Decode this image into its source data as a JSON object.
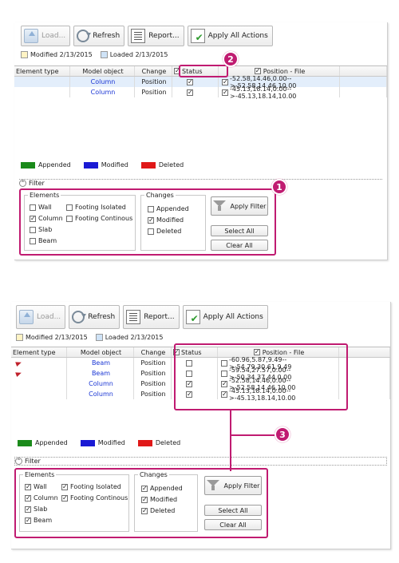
{
  "toolbar": {
    "load_label": "Load...",
    "refresh_label": "Refresh",
    "report_label": "Report...",
    "apply_label": "Apply All Actions"
  },
  "info": {
    "modified": "Modified 2/13/2015",
    "loaded": "Loaded 2/13/2015"
  },
  "grid": {
    "columns": [
      "Element type",
      "Model object",
      "Change",
      "Status",
      "Position - File"
    ]
  },
  "panel1": {
    "rows": [
      {
        "object": "Column",
        "change": "Position",
        "status": true,
        "file_checked": true,
        "position": "-52.58,14.46,0.00-->-52.58,14.46,10.00"
      },
      {
        "object": "Column",
        "change": "Position",
        "status": true,
        "file_checked": true,
        "position": "-45.13,18.14,0.00-->-45.13,18.14,10.00"
      }
    ],
    "elements": [
      {
        "label": "Wall",
        "checked": false
      },
      {
        "label": "Footing Isolated",
        "checked": false
      },
      {
        "label": "Column",
        "checked": true
      },
      {
        "label": "Footing Continous",
        "checked": false
      },
      {
        "label": "Slab",
        "checked": false
      },
      {
        "label": "Beam",
        "checked": false
      }
    ],
    "changes": [
      {
        "label": "Appended",
        "checked": false
      },
      {
        "label": "Modified",
        "checked": true
      },
      {
        "label": "Deleted",
        "checked": false
      }
    ]
  },
  "panel2": {
    "rows": [
      {
        "object": "Beam",
        "change": "Position",
        "status": false,
        "file_checked": false,
        "flag": true,
        "position": "-60.96,5.87,9.49-->-54.79,30.61,9.49"
      },
      {
        "object": "Beam",
        "change": "Position",
        "status": false,
        "file_checked": false,
        "flag": true,
        "position": "-59.54,27.57,0.00-->-50.34,37.44,0.00"
      },
      {
        "object": "Column",
        "change": "Position",
        "status": true,
        "file_checked": true,
        "flag": false,
        "position": "-52.58,14.46,0.00-->-52.58,14.46,10.00"
      },
      {
        "object": "Column",
        "change": "Position",
        "status": true,
        "file_checked": true,
        "flag": false,
        "position": "-45.13,18.14,0.00-->-45.13,18.14,10.00"
      }
    ],
    "elements": [
      {
        "label": "Wall",
        "checked": true
      },
      {
        "label": "Footing Isolated",
        "checked": true
      },
      {
        "label": "Column",
        "checked": true
      },
      {
        "label": "Footing Continous",
        "checked": true
      },
      {
        "label": "Slab",
        "checked": true
      },
      {
        "label": "Beam",
        "checked": true
      }
    ],
    "changes": [
      {
        "label": "Appended",
        "checked": true
      },
      {
        "label": "Modified",
        "checked": true
      },
      {
        "label": "Deleted",
        "checked": true
      }
    ]
  },
  "legend": [
    {
      "label": "Appended",
      "color": "#1a8a1a"
    },
    {
      "label": "Modified",
      "color": "#1a1ad4"
    },
    {
      "label": "Deleted",
      "color": "#e01818"
    }
  ],
  "filter": {
    "label": "Filter",
    "elements_title": "Elements",
    "changes_title": "Changes",
    "apply_label": "Apply Filter",
    "select_all_label": "Select All",
    "clear_all_label": "Clear All"
  },
  "callouts": [
    "1",
    "2",
    "3"
  ],
  "accent_color": "#c01b71"
}
